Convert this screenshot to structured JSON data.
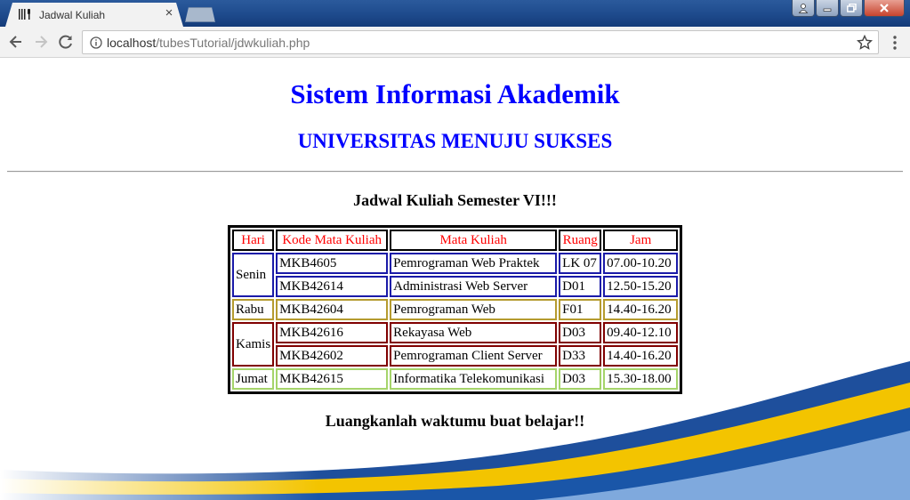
{
  "browser": {
    "tab_title": "Jadwal Kuliah",
    "tab_close": "×",
    "url_host": "localhost",
    "url_path": "/tubesTutorial/jdwkuliah.php"
  },
  "page": {
    "title": "Sistem Informasi Akademik",
    "subtitle": "UNIVERSITAS MENUJU SUKSES",
    "schedule_title": "Jadwal Kuliah Semester VI!!!",
    "footer": "Luangkanlah waktumu buat belajar!!"
  },
  "table": {
    "headers": [
      "Hari",
      "Kode Mata Kuliah",
      "Mata Kuliah",
      "Ruang",
      "Jam"
    ],
    "days": [
      "Senin",
      "Rabu",
      "Kamis",
      "Jumat"
    ],
    "rows": [
      [
        "MKB4605",
        "Pemrograman Web Praktek",
        "LK 07",
        "07.00-10.20"
      ],
      [
        "MKB42614",
        "Administrasi Web Server",
        "D01",
        "12.50-15.20"
      ],
      [
        "MKB42604",
        "Pemrograman Web",
        "F01",
        "14.40-16.20"
      ],
      [
        "MKB42616",
        "Rekayasa Web",
        "D03",
        "09.40-12.10"
      ],
      [
        "MKB42602",
        "Pemrograman Client Server",
        "D33",
        "14.40-16.20"
      ],
      [
        "MKB42615",
        "Informatika Telekomunikasi",
        "D03",
        "15.30-18.00"
      ]
    ]
  },
  "colors": {
    "heading": "#0000ff",
    "header_text": "#ff0000",
    "senin_border": "#1a1aa8",
    "rabu_border": "#b59b2f",
    "kamis_border": "#800000",
    "jumat_border": "#a5d46a"
  }
}
